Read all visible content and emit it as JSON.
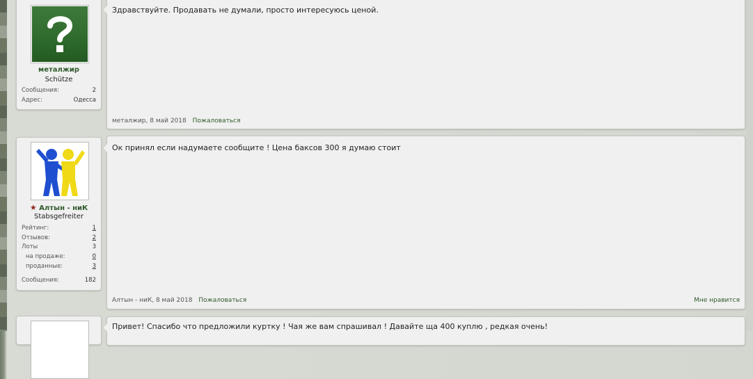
{
  "posts": [
    {
      "username": "металжир",
      "user_title": "Schütze",
      "stats": [
        {
          "label": "Сообщения:",
          "value": "2"
        },
        {
          "label": "Адрес:",
          "value": "Одесса"
        }
      ],
      "message": "Здравствуйте. Продавать не думали, просто интересуюсь ценой.",
      "footer_meta": "металжир, 8 май 2018",
      "report_label": "Пожаловаться"
    },
    {
      "username": "Алтын - ниК",
      "user_title": "Stabsgefreiter",
      "stats": [
        {
          "label": "Рейтинг:",
          "value": "1"
        },
        {
          "label": "Отзывов:",
          "value": "2"
        },
        {
          "label": "Лоты",
          "value": "3"
        },
        {
          "label": "на продаже:",
          "value": "0"
        },
        {
          "label": "проданные:",
          "value": "3"
        },
        {
          "label": "Сообщения:",
          "value": "182"
        }
      ],
      "message": "Ок принял если надумаете сообщите ! Цена баксов 300 я думаю стоит",
      "footer_meta": "Алтын - ниК, 8 май 2018",
      "report_label": "Пожаловаться",
      "like_label": "Мне нравится"
    },
    {
      "message": "Привет! Спасибо что предложили куртку ! Чая же вам спрашивал ! Давайте ща 400 куплю , редкая очень!"
    }
  ],
  "icons": {
    "avatar_placeholder": "question-mark-icon",
    "rank_star": "star-icon"
  },
  "colors": {
    "accent_green": "#2f5a2a",
    "panel_bg": "#f0f0f0"
  }
}
